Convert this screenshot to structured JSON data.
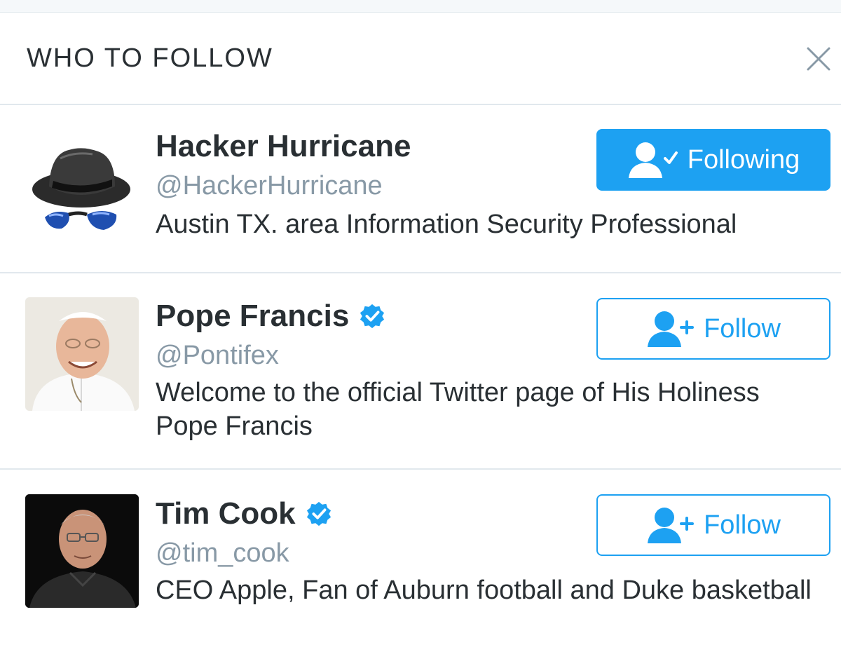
{
  "panel": {
    "title": "WHO TO FOLLOW",
    "close_icon": "close-icon"
  },
  "colors": {
    "accent": "#1da1f2",
    "text": "#292f33",
    "muted": "#8899a6",
    "divider": "#e1e8ed"
  },
  "suggestions": [
    {
      "name": "Hacker Hurricane",
      "handle": "@HackerHurricane",
      "bio": "Austin TX. area Information Security Professional",
      "verified": false,
      "button_label": "Following",
      "button_state": "following",
      "button_icon": "user-check-icon"
    },
    {
      "name": "Pope Francis",
      "handle": "@Pontifex",
      "bio": "Welcome to the official Twitter page of His Holiness Pope Francis",
      "verified": true,
      "button_label": "Follow",
      "button_state": "follow",
      "button_icon": "user-add-icon"
    },
    {
      "name": "Tim Cook",
      "handle": "@tim_cook",
      "bio": "CEO Apple, Fan of Auburn football and Duke basketball",
      "verified": true,
      "button_label": "Follow",
      "button_state": "follow",
      "button_icon": "user-add-icon"
    }
  ]
}
